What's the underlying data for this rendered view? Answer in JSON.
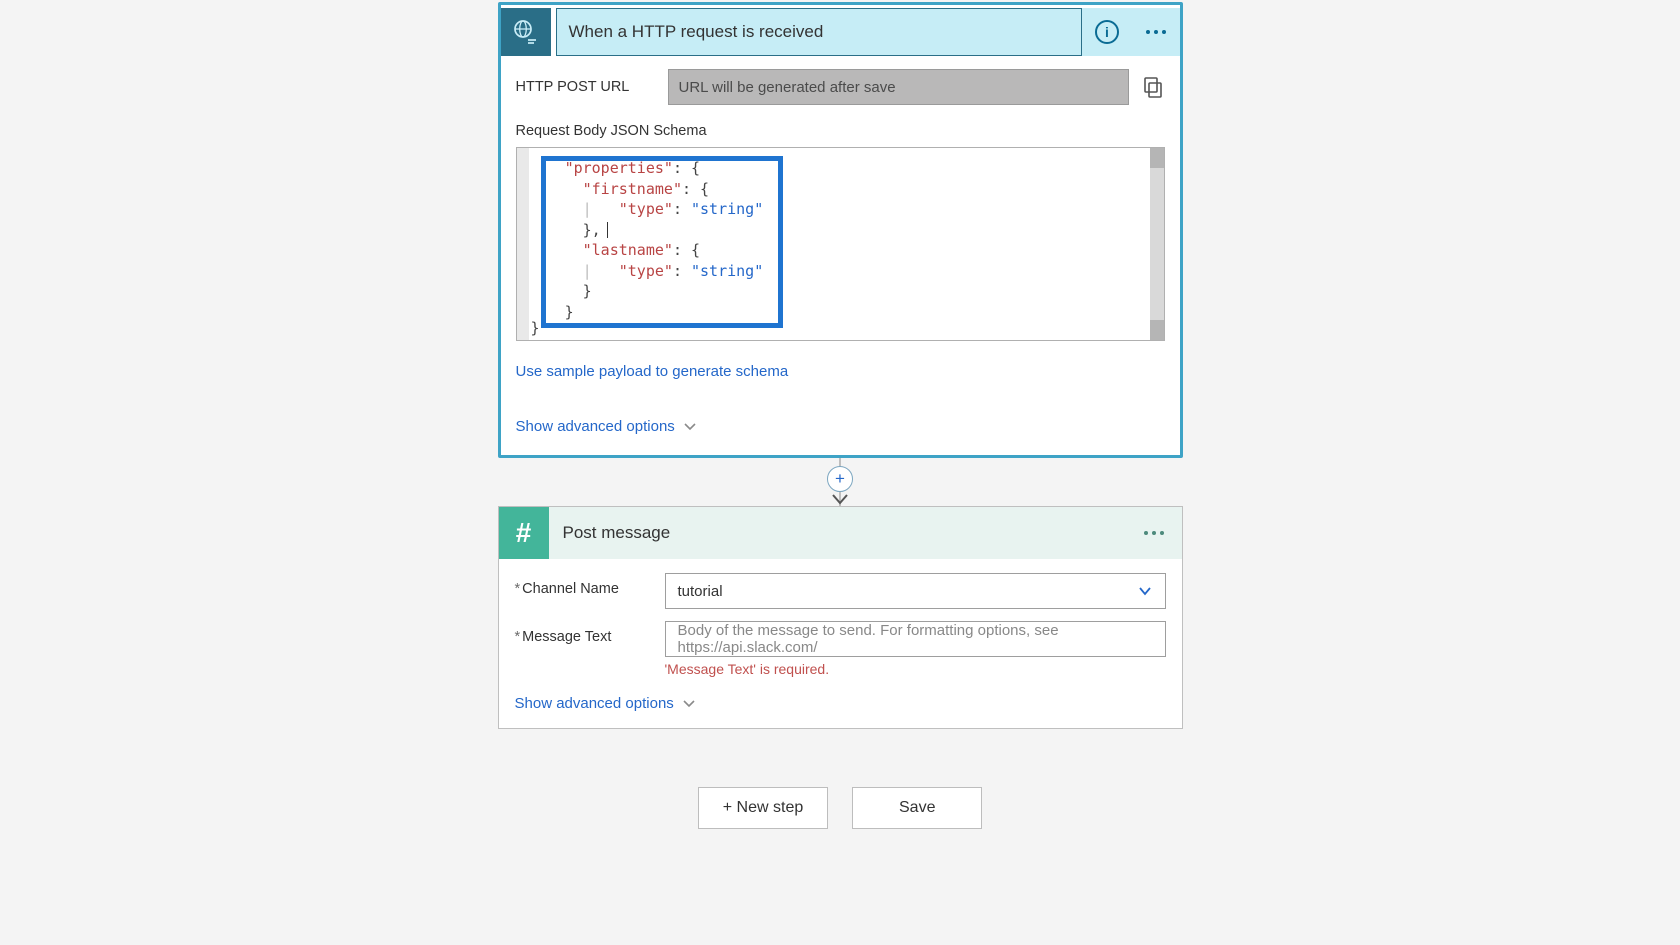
{
  "trigger": {
    "title": "When a HTTP request is received",
    "url_label": "HTTP POST URL",
    "url_value": "URL will be generated after save",
    "schema_label": "Request Body JSON Schema",
    "schema_lines": {
      "l1_key": "properties",
      "l2_key": "firstname",
      "l3_key": "type",
      "l3_val": "string",
      "l4_key": "lastname",
      "l5_key": "type",
      "l5_val": "string"
    },
    "sample_link": "Use sample payload to generate schema",
    "advanced_link": "Show advanced options"
  },
  "action": {
    "title": "Post message",
    "channel_label": "Channel Name",
    "channel_value": "tutorial",
    "message_label": "Message Text",
    "message_placeholder": "Body of the message to send. For formatting options, see https://api.slack.com/",
    "message_error": "'Message Text' is required.",
    "advanced_link": "Show advanced options"
  },
  "footer": {
    "new_step": "+ New step",
    "save": "Save"
  }
}
